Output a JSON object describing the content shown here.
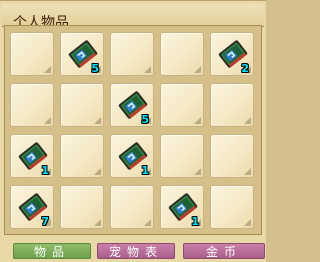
{
  "window": {
    "title": "个人物品"
  },
  "grid": {
    "rows": [
      [
        {
          "item": null
        },
        {
          "item": "scroll-card",
          "count": "5"
        },
        {
          "item": null
        },
        {
          "item": null
        },
        {
          "item": "scroll-card",
          "count": "2"
        }
      ],
      [
        {
          "item": null
        },
        {
          "item": null
        },
        {
          "item": "scroll-card",
          "count": "5"
        },
        {
          "item": null
        },
        {
          "item": null
        }
      ],
      [
        {
          "item": "scroll-card",
          "count": "1"
        },
        {
          "item": null
        },
        {
          "item": "scroll-card",
          "count": "1"
        },
        {
          "item": null
        },
        {
          "item": null
        }
      ],
      [
        {
          "item": "scroll-card",
          "count": "7"
        },
        {
          "item": null
        },
        {
          "item": null
        },
        {
          "item": "scroll-card",
          "count": "1"
        },
        {
          "item": null
        }
      ]
    ]
  },
  "tabs": {
    "items_label": "物品",
    "pets_label": "宠物表",
    "gold_label": "金币"
  },
  "colors": {
    "count_text": "#00e5ff",
    "tab_active": "#7faf5a",
    "tab_inactive": "#b86f98"
  }
}
